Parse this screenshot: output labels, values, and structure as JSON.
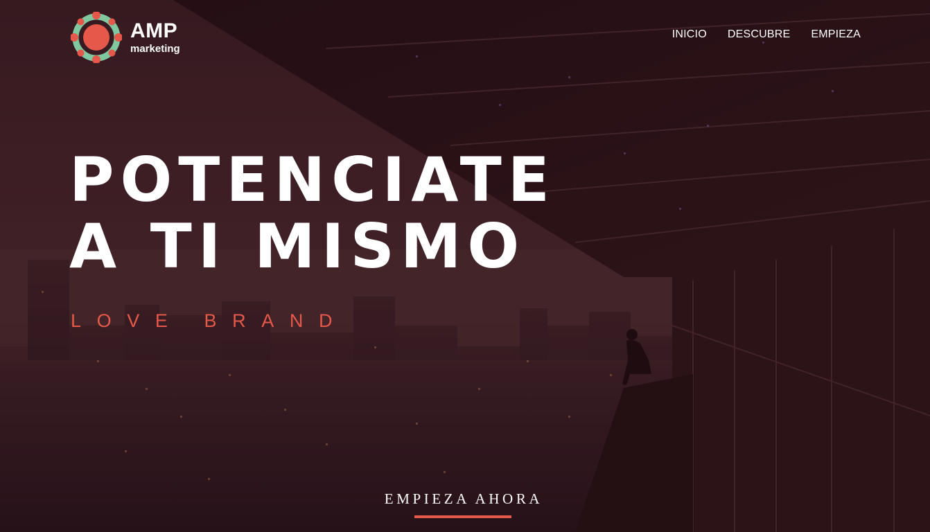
{
  "brand": {
    "name": "AMP",
    "sub": "marketing"
  },
  "nav": {
    "items": [
      {
        "label": "INICIO"
      },
      {
        "label": "DESCUBRE"
      },
      {
        "label": "EMPIEZA"
      }
    ]
  },
  "hero": {
    "headline_line1": "POTENCIATE",
    "headline_line2": "A TI MISMO",
    "tagline": "LOVE BRAND",
    "cta_label": "EMPIEZA AHORA",
    "background": "night city skyline viewed from a glass balcony with a seated figure"
  },
  "colors": {
    "accent": "#e5584a",
    "logo_green": "#7fc8a0",
    "text": "#ffffff",
    "overlay": "#301218"
  },
  "icons": {
    "logo": "amp-logo-icon"
  }
}
